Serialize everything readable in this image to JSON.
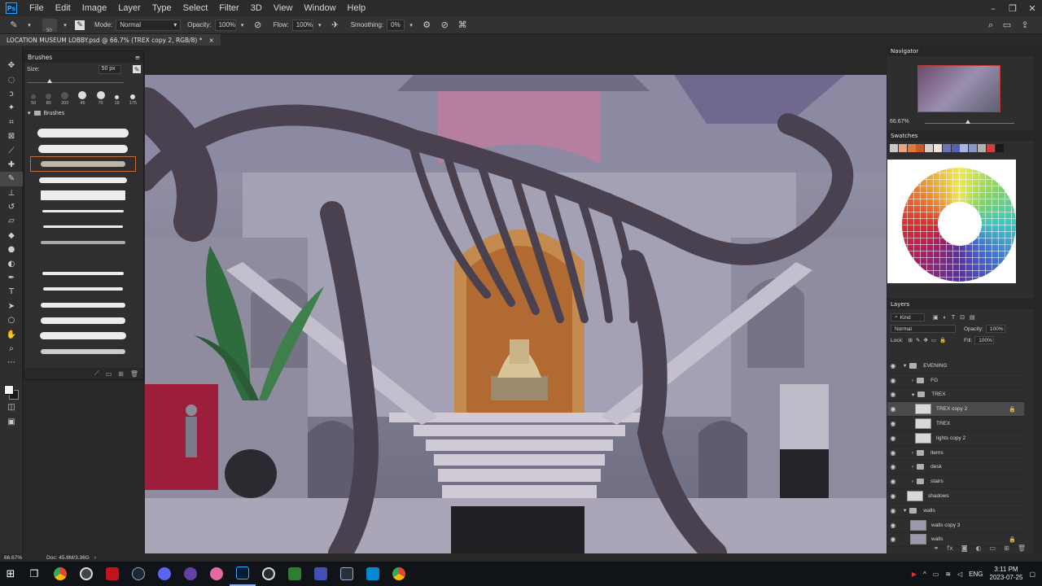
{
  "app": {
    "logo_text": "Ps",
    "menu": [
      "File",
      "Edit",
      "Image",
      "Layer",
      "Type",
      "Select",
      "Filter",
      "3D",
      "View",
      "Window",
      "Help"
    ]
  },
  "options": {
    "brush_size": "50",
    "mode_label": "Mode:",
    "mode_value": "Normal",
    "opacity_label": "Opacity:",
    "opacity_value": "100%",
    "flow_label": "Flow:",
    "flow_value": "100%",
    "smoothing_label": "Smoothing:",
    "smoothing_value": "0%"
  },
  "document": {
    "tab_title": "LOCATION MUSEUM LOBBY.psd @ 66.7% (TREX copy 2, RGB/8) *",
    "close": "×"
  },
  "brushes_panel": {
    "title": "Brushes",
    "size_label": "Size:",
    "size_value": "50 px",
    "presets": [
      "50",
      "80",
      "200",
      "45",
      "70",
      "19",
      "175"
    ],
    "folder_label": "Brushes"
  },
  "navigator": {
    "title": "Navigator",
    "zoom": "66.67%"
  },
  "swatches": {
    "title": "Swatches",
    "colors": [
      "#c8c8c8",
      "#e8a58a",
      "#e07a3a",
      "#c45b2a",
      "#d8d0c8",
      "#f0e4d8",
      "#6a73b8",
      "#5261b0",
      "#a8b6e0",
      "#8896c8",
      "#b0b0b0",
      "#d43c3c",
      "#1a1a1a"
    ]
  },
  "layers_panel": {
    "title": "Layers",
    "kind": "Kind",
    "blend": "Normal",
    "opacity_label": "Opacity:",
    "opacity_value": "100%",
    "lock_label": "Lock:",
    "fill_label": "Fill:",
    "fill_value": "100%",
    "layers": [
      {
        "name": "EVENING",
        "type": "folder"
      },
      {
        "name": "FG",
        "type": "folder"
      },
      {
        "name": "TREX",
        "type": "folder"
      },
      {
        "name": "TREX copy 2",
        "type": "layer"
      },
      {
        "name": "TREX",
        "type": "layer"
      },
      {
        "name": "lights copy 2",
        "type": "layer"
      },
      {
        "name": "items",
        "type": "folder"
      },
      {
        "name": "desk",
        "type": "folder"
      },
      {
        "name": "stairs",
        "type": "folder"
      },
      {
        "name": "shadows",
        "type": "layer"
      },
      {
        "name": "walls",
        "type": "folder"
      },
      {
        "name": "walls copy 3",
        "type": "layer"
      },
      {
        "name": "walls",
        "type": "layer"
      }
    ]
  },
  "status": {
    "zoom": "66.67%",
    "doc": "Doc: 45.8M/3.36G"
  },
  "taskbar": {
    "language": "ENG",
    "time": "3:11 PM",
    "date": "2023-07-25"
  }
}
